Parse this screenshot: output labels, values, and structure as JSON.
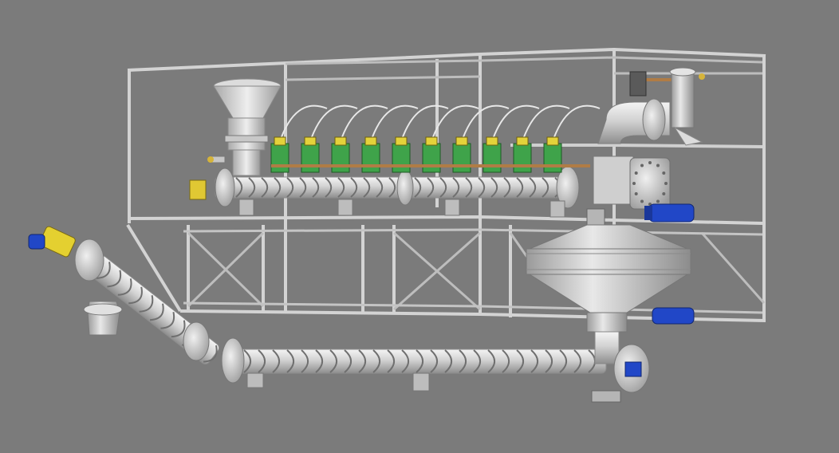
{
  "scene": {
    "background": "#7b7b7b",
    "colors": {
      "frame": "#cfcfcf",
      "frame_shadow": "#8a8a8a",
      "metal": "#d9d9d9",
      "metal_dark": "#9a9a9a",
      "valve_green": "#3fa34a",
      "valve_yellow": "#e4d23a",
      "motor_blue": "#1f3fc4",
      "gearbox_yellow": "#e8d631",
      "copper_pipe": "#b5834a"
    },
    "objects": [
      "structural-frame",
      "feed-hopper",
      "upper-screw-conveyor",
      "valve-bank",
      "cyclone-separator",
      "inspection-hatch",
      "conical-settling-tank",
      "lower-screw-conveyor",
      "inclined-screw-conveyor",
      "drive-motor-left",
      "drive-motor-right",
      "blue-motor-upper",
      "blue-motor-lower"
    ]
  }
}
